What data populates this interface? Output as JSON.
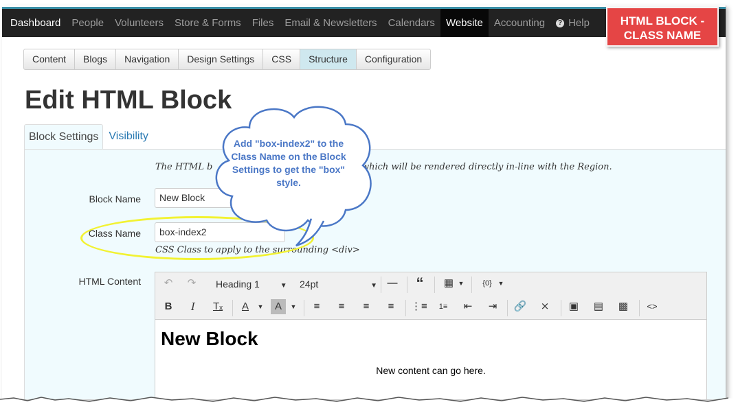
{
  "topnav": {
    "items": [
      {
        "label": "Dashboard",
        "style": "bright"
      },
      {
        "label": "People",
        "style": "normal"
      },
      {
        "label": "Volunteers",
        "style": "normal"
      },
      {
        "label": "Store & Forms",
        "style": "normal"
      },
      {
        "label": "Files",
        "style": "normal"
      },
      {
        "label": "Email & Newsletters",
        "style": "normal"
      },
      {
        "label": "Calendars",
        "style": "normal"
      },
      {
        "label": "Website",
        "style": "active"
      },
      {
        "label": "Accounting",
        "style": "normal"
      }
    ],
    "help_label": "Help"
  },
  "callout_badge": {
    "line1": "HTML BLOCK -",
    "line2": "CLASS NAME"
  },
  "subtabs": [
    "Content",
    "Blogs",
    "Navigation",
    "Design Settings",
    "CSS",
    "Structure",
    "Configuration"
  ],
  "subtabs_active": "Structure",
  "page_title": "Edit HTML Block",
  "tabs": {
    "block_settings": "Block Settings",
    "visibility": "Visibility"
  },
  "intro_text_left": "The HTML b",
  "intro_text_right": "own HTML, which will be rendered directly in-line with the Region.",
  "form": {
    "block_name_label": "Block Name",
    "block_name_value": "New Block",
    "class_name_label": "Class Name",
    "class_name_value": "box-index2",
    "class_name_help": "CSS Class to apply to the surrounding <div>",
    "html_content_label": "HTML Content"
  },
  "editor": {
    "format_select": "Heading 1",
    "size_select": "24pt",
    "content_heading": "New Block",
    "content_paragraph": "New content can go here."
  },
  "cloud_callout": {
    "text": "Add \"box-index2\" to the Class Name on the Block Settings to get the \"box\" style."
  },
  "colors": {
    "topbar": "#222222",
    "badge": "#e54545",
    "highlight": "#f2f232",
    "callout_text": "#4a77c6",
    "panel_bg": "#f0fbfe"
  }
}
